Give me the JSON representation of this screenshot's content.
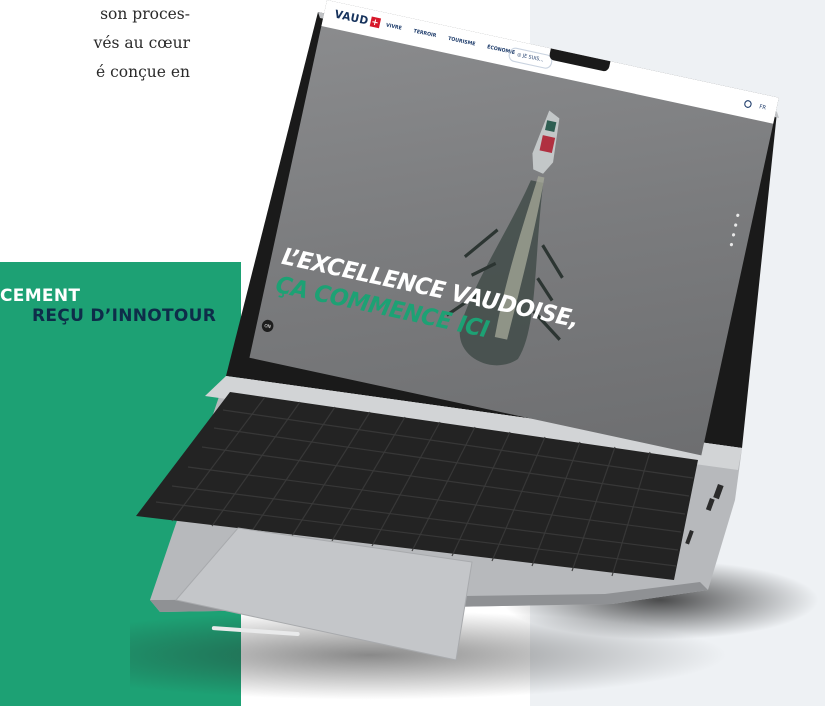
{
  "intro_text": {
    "lines": [
      "son proces-",
      "vés au cœur",
      "é conçue en"
    ]
  },
  "award": {
    "line1": "CEMENT",
    "line2": "REÇU D’INNOTOUR"
  },
  "website": {
    "logo": "VAUD",
    "nav_items": [
      "VIVRE",
      "TERROIR",
      "TOURISME",
      "ÉCONOMIE"
    ],
    "je_suis_label": "JE SUIS...",
    "lang": "FR",
    "hero_line1": "L’EXCELLENCE VAUDOISE,",
    "hero_line2": "ÇA COMMENCE ICI",
    "badge": "ON"
  },
  "colors": {
    "green": "#1da174",
    "navy": "#0e2d49",
    "vaud_red": "#d7182a"
  },
  "icons": [
    "search-icon",
    "globe-icon",
    "vaud-cross-logo"
  ]
}
